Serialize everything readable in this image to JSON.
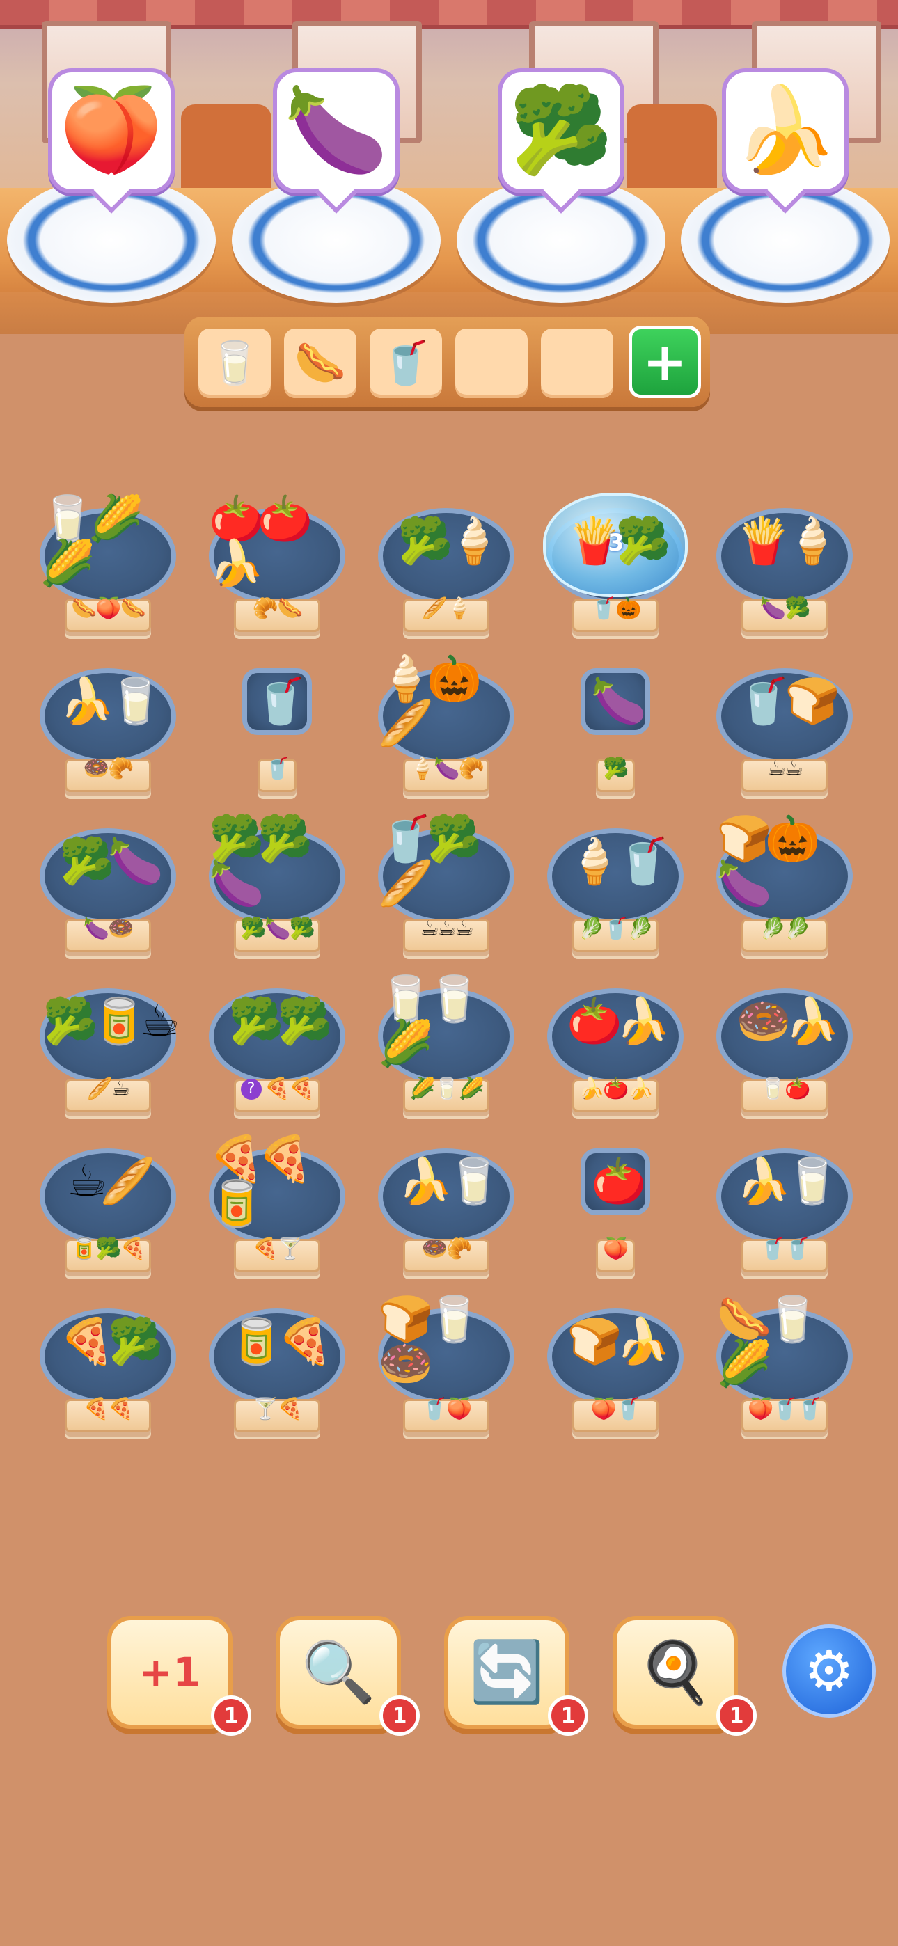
{
  "orders": [
    {
      "item": "🍑",
      "icon": "peach-icon"
    },
    {
      "item": "🍆",
      "icon": "eggplant-icon"
    },
    {
      "item": "🥦",
      "icon": "broccoli-icon"
    },
    {
      "item": "🍌",
      "icon": "banana-icon"
    }
  ],
  "holding_slots": [
    {
      "item": "🥛",
      "icon": "milk-carton-icon"
    },
    {
      "item": "🌭",
      "icon": "hotdog-icon"
    },
    {
      "item": "🥤",
      "icon": "cola-cup-icon"
    },
    {
      "item": "",
      "icon": "empty-slot"
    },
    {
      "item": "",
      "icon": "empty-slot"
    }
  ],
  "add_slot_label": "+",
  "board": [
    [
      {
        "top": "🥛🌽🌽",
        "under": "🌭🍑🌭"
      },
      {
        "top": "🍅🍅🍌",
        "under": "🥐🌭"
      },
      {
        "top": "🥦🍦",
        "under": "🥖🍦"
      },
      {
        "top": "🍟🥦",
        "under": "🥤🎃",
        "frozen": true,
        "frozen_count": "3"
      },
      {
        "top": "🍟🍦",
        "under": "🍆🥦"
      }
    ],
    [
      {
        "top": "🍌🥛",
        "under": "🍩🥐"
      },
      {
        "top": "🥤",
        "under": "🥤",
        "small": true
      },
      {
        "top": "🍦🎃🥖",
        "under": "🍦🍆🥐"
      },
      {
        "top": "🍆",
        "under": "🥦",
        "small": true
      },
      {
        "top": "🥤🍞",
        "under": "☕☕"
      }
    ],
    [
      {
        "top": "🥦🍆",
        "under": "🍆🍩"
      },
      {
        "top": "🥦🥦🍆",
        "under": "🥦🍆🥦"
      },
      {
        "top": "🥤🥦🥖",
        "under": "☕☕☕"
      },
      {
        "top": "🍦🥤",
        "under": "🥬🥤🥬"
      },
      {
        "top": "🍞🎃🍆",
        "under": "🥬🥬"
      }
    ],
    [
      {
        "top": "🥦🥫☕",
        "under": "🥖☕"
      },
      {
        "top": "🥦🥦",
        "under": "🍕🍕",
        "mystery": "?"
      },
      {
        "top": "🥛🥛🌽",
        "under": "🌽🥛🌽"
      },
      {
        "top": "🍅🍌",
        "under": "🍌🍅🍌"
      },
      {
        "top": "🍩🍌",
        "under": "🥛🍅"
      }
    ],
    [
      {
        "top": "☕🥖",
        "under": "🥫🥦🍕"
      },
      {
        "top": "🍕🍕🥫",
        "under": "🍕🍸"
      },
      {
        "top": "🍌🥛",
        "under": "🍩🥐"
      },
      {
        "top": "🍅",
        "under": "🍑",
        "small": true
      },
      {
        "top": "🍌🥛",
        "under": "🥤🥤"
      }
    ],
    [
      {
        "top": "🍕🥦",
        "under": "🍕🍕"
      },
      {
        "top": "🥫🍕",
        "under": "🍸🍕"
      },
      {
        "top": "🍞🥛🍩",
        "under": "🥤🍑"
      },
      {
        "top": "🍞🍌",
        "under": "🍑🥤"
      },
      {
        "top": "🌭🥛🌽",
        "under": "🍑🥤🥤"
      }
    ]
  ],
  "boosters": [
    {
      "name": "extra-plate",
      "label": "+1",
      "count": "1"
    },
    {
      "name": "magnifier",
      "label": "🔍",
      "count": "1"
    },
    {
      "name": "shuffle",
      "label": "🔄",
      "count": "1"
    },
    {
      "name": "spatula",
      "label": "🍳",
      "count": "1"
    }
  ],
  "settings_label": "⚙"
}
